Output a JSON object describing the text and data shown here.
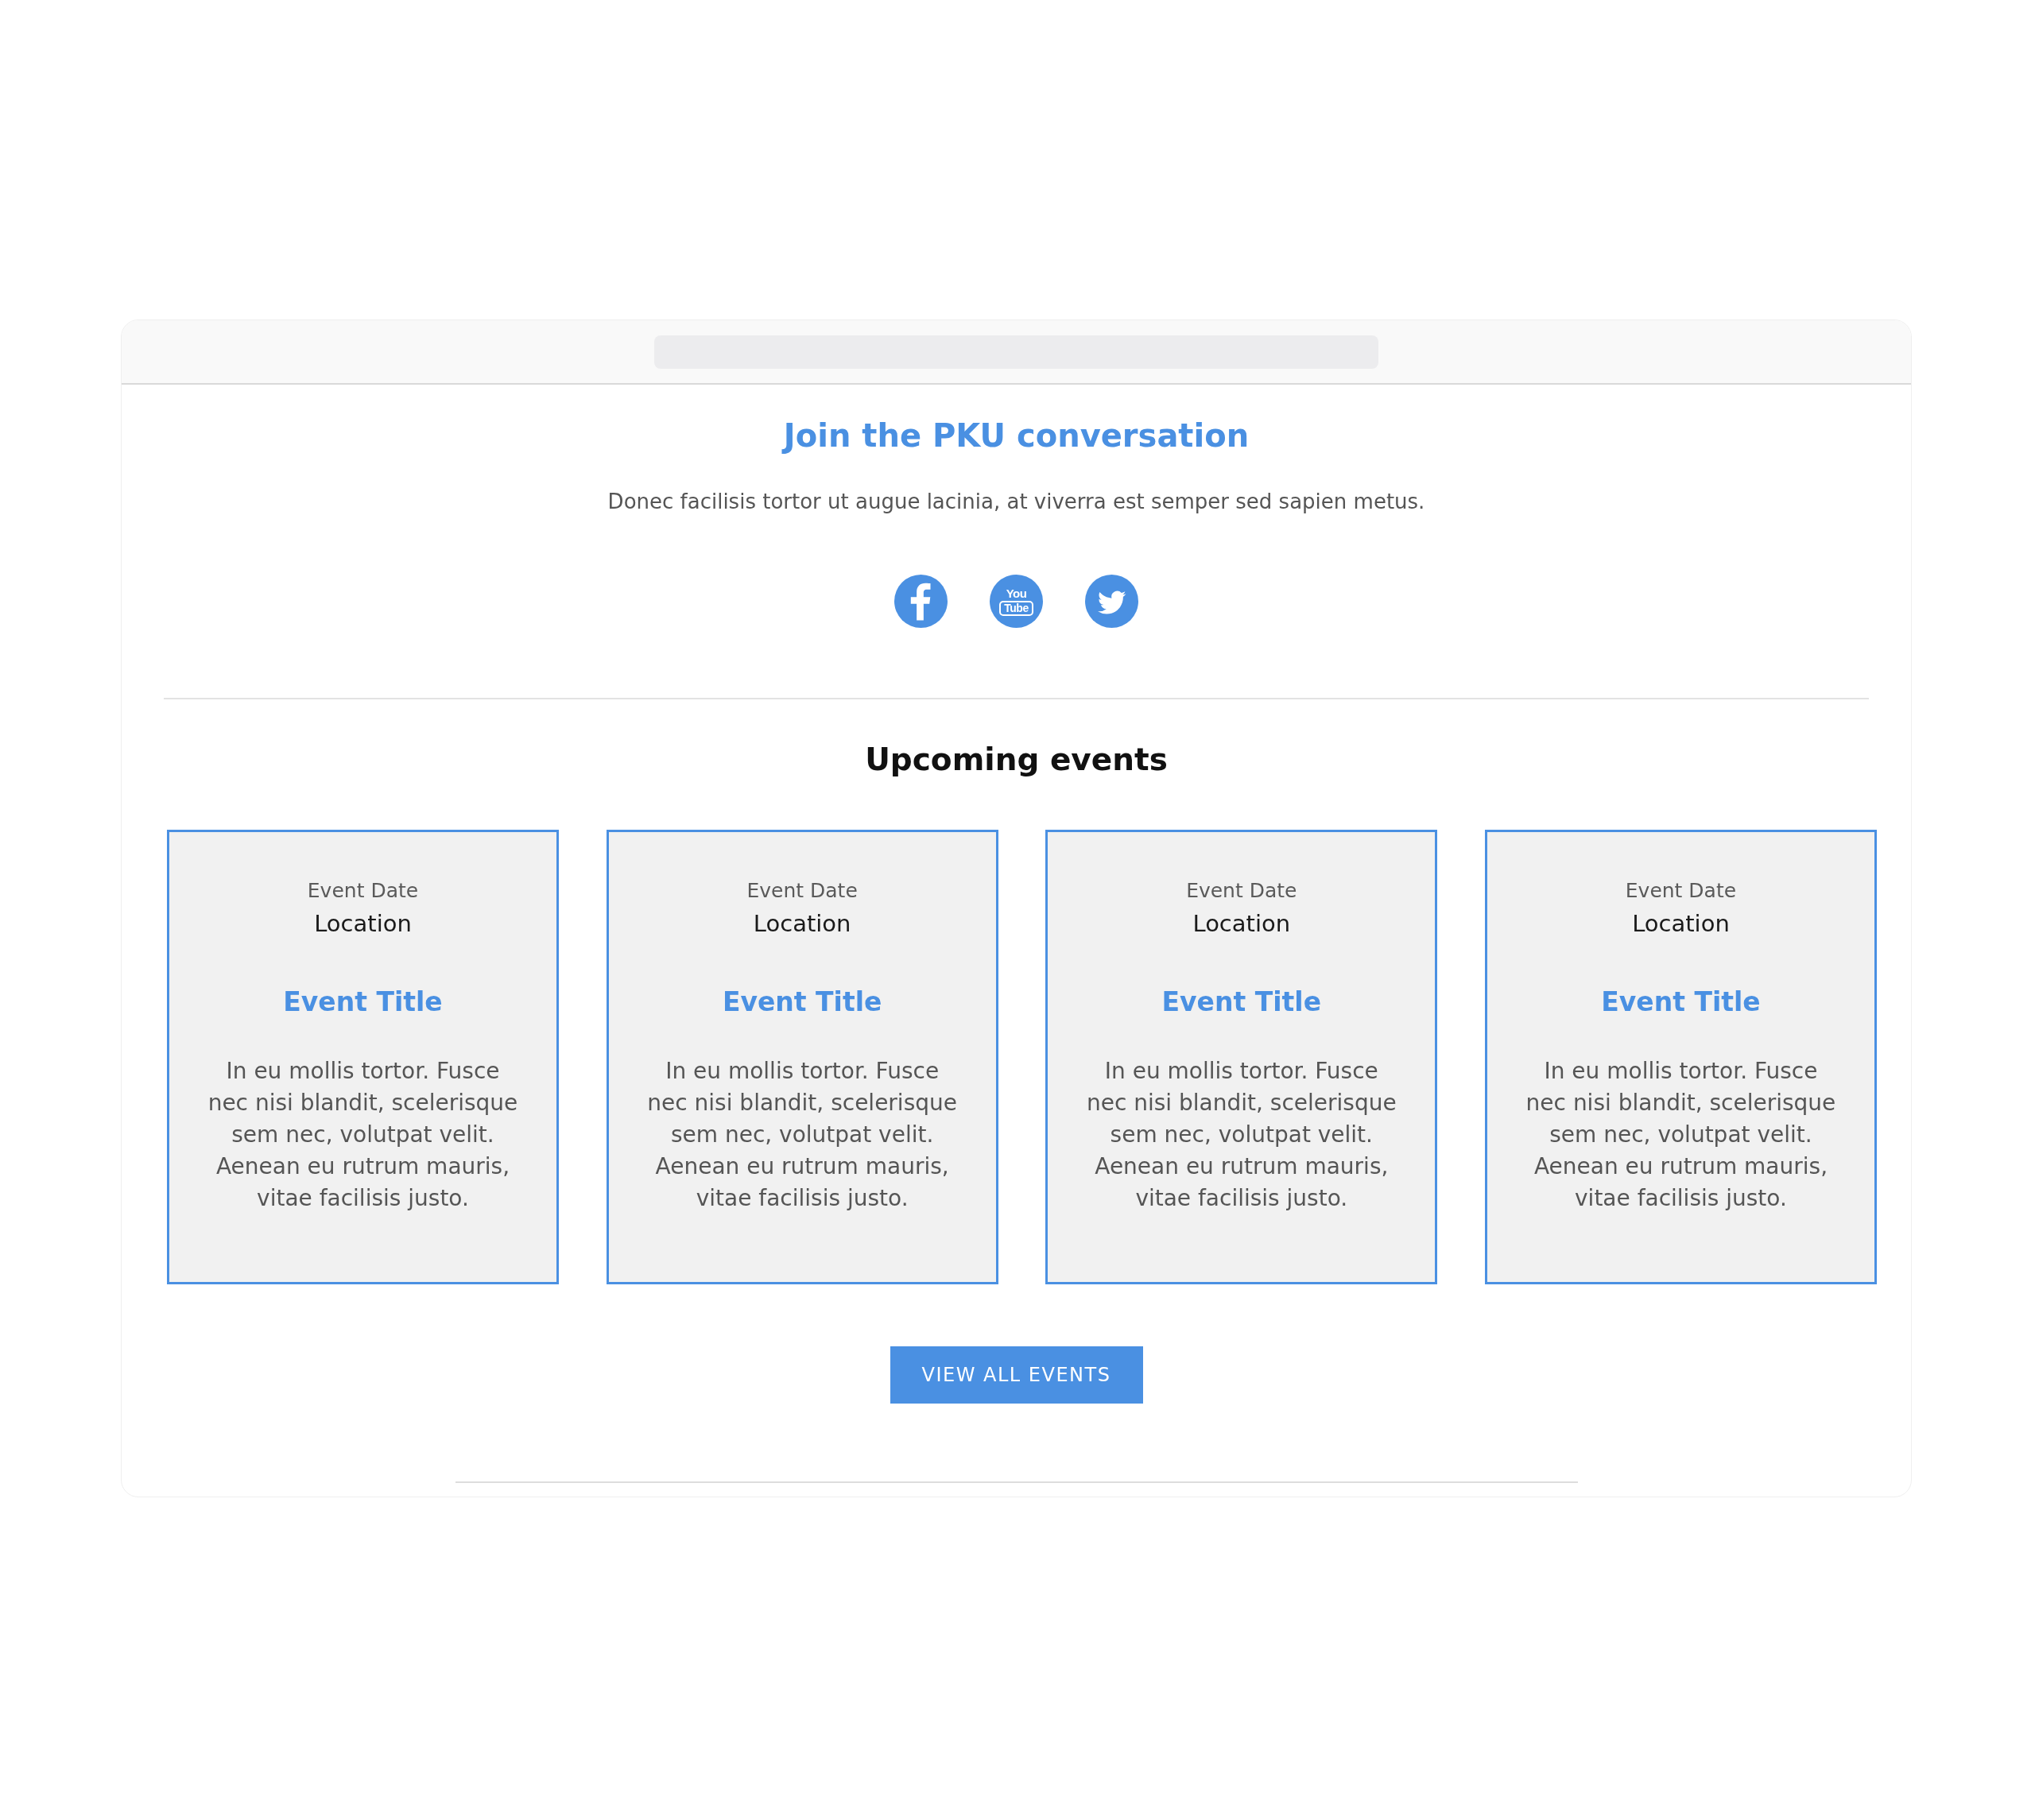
{
  "conversation": {
    "title": "Join the PKU conversation",
    "subtitle": "Donec facilisis tortor ut augue lacinia, at viverra est semper sed sapien metus.",
    "social_links": [
      {
        "kind": "facebook"
      },
      {
        "kind": "youtube",
        "logo_text": [
          "You",
          "Tube"
        ]
      },
      {
        "kind": "twitter"
      }
    ]
  },
  "events": {
    "heading": "Upcoming events",
    "cards": [
      {
        "date": "Event Date",
        "location": "Location",
        "title": "Event Title",
        "description": "In eu mollis tortor. Fusce nec nisi blandit, scelerisque sem nec, volutpat velit. Aenean eu rutrum mauris, vitae facilisis justo."
      },
      {
        "date": "Event Date",
        "location": "Location",
        "title": "Event Title",
        "description": "In eu mollis tortor. Fusce nec nisi blandit, scelerisque sem nec, volutpat velit. Aenean eu rutrum mauris, vitae facilisis justo."
      },
      {
        "date": "Event Date",
        "location": "Location",
        "title": "Event Title",
        "description": "In eu mollis tortor. Fusce nec nisi blandit, scelerisque sem nec, volutpat velit. Aenean eu rutrum mauris, vitae facilisis justo."
      },
      {
        "date": "Event Date",
        "location": "Location",
        "title": "Event Title",
        "description": "In eu mollis tortor. Fusce nec nisi blandit, scelerisque sem nec, volutpat velit. Aenean eu rutrum mauris, vitae facilisis justo."
      }
    ],
    "button": "VIEW ALL EVENTS"
  }
}
